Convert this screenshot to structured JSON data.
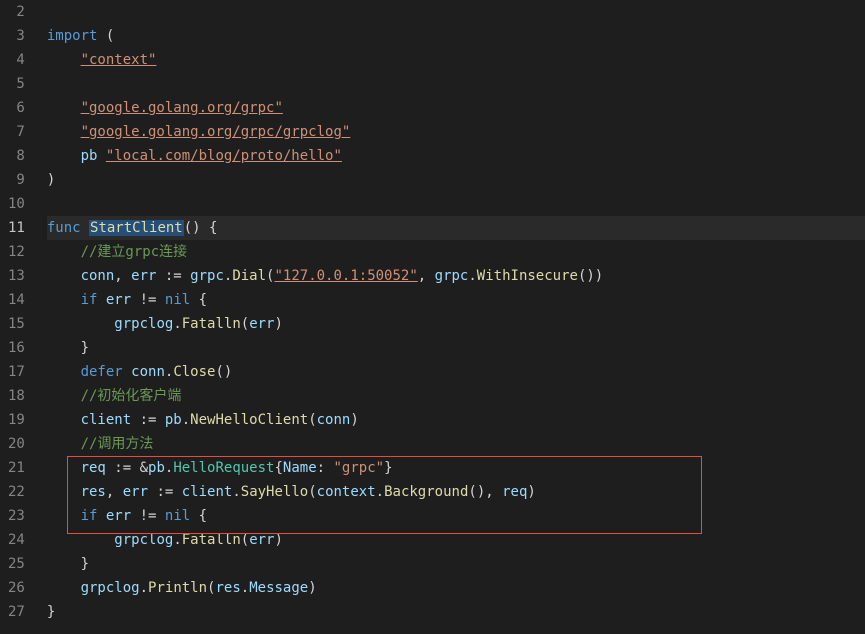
{
  "lineNumbers": [
    "2",
    "3",
    "4",
    "5",
    "6",
    "7",
    "8",
    "9",
    "10",
    "11",
    "12",
    "13",
    "14",
    "15",
    "16",
    "17",
    "18",
    "19",
    "20",
    "21",
    "22",
    "23",
    "24",
    "25",
    "26",
    "27"
  ],
  "currentLine": 11,
  "code": {
    "l3_import": "import",
    "l3_paren": " (",
    "l4_str": "\"context\"",
    "l6_str": "\"google.golang.org/grpc\"",
    "l7_str": "\"google.golang.org/grpc/grpclog\"",
    "l8_pb": "pb ",
    "l8_str": "\"local.com/blog/proto/hello\"",
    "l9_paren": ")",
    "l11_func": "func",
    "l11_name": "StartClient",
    "l11_sig": "() {",
    "l12_comment": "//建立grpc连接",
    "l13_conn": "conn",
    "l13_comma": ", ",
    "l13_err": "err",
    "l13_assign": " := ",
    "l13_grpc": "grpc",
    "l13_dot": ".",
    "l13_dial": "Dial",
    "l13_open": "(",
    "l13_addr": "\"127.0.0.1:50052\"",
    "l13_comma2": ", ",
    "l13_grpc2": "grpc",
    "l13_dot2": ".",
    "l13_withins": "WithInsecure",
    "l13_close": "())",
    "l14_if": "if",
    "l14_sp": " ",
    "l14_err": "err",
    "l14_ne": " != ",
    "l14_nil": "nil",
    "l14_brace": " {",
    "l15_grpclog": "grpclog",
    "l15_dot": ".",
    "l15_fatal": "Fatalln",
    "l15_open": "(",
    "l15_err": "err",
    "l15_close": ")",
    "l16_brace": "}",
    "l17_defer": "defer",
    "l17_sp": " ",
    "l17_conn": "conn",
    "l17_dot": ".",
    "l17_close": "Close",
    "l17_paren": "()",
    "l18_comment": "//初始化客户端",
    "l19_client": "client",
    "l19_assign": " := ",
    "l19_pb": "pb",
    "l19_dot": ".",
    "l19_newhello": "NewHelloClient",
    "l19_open": "(",
    "l19_conn": "conn",
    "l19_close": ")",
    "l20_comment": "//调用方法",
    "l21_req": "req",
    "l21_assign": " := &",
    "l21_pb": "pb",
    "l21_dot": ".",
    "l21_hr": "HelloRequest",
    "l21_brace": "{",
    "l21_name": "Name",
    "l21_colon": ": ",
    "l21_grpc": "\"grpc\"",
    "l21_close": "}",
    "l22_res": "res",
    "l22_comma": ", ",
    "l22_err": "err",
    "l22_assign": " := ",
    "l22_client": "client",
    "l22_dot": ".",
    "l22_sayhello": "SayHello",
    "l22_open": "(",
    "l22_context": "context",
    "l22_dot2": ".",
    "l22_bg": "Background",
    "l22_paren": "(), ",
    "l22_req": "req",
    "l22_close": ")",
    "l23_if": "if",
    "l23_sp": " ",
    "l23_err": "err",
    "l23_ne": " != ",
    "l23_nil": "nil",
    "l23_brace": " {",
    "l24_grpclog": "grpclog",
    "l24_dot": ".",
    "l24_fatal": "Fatalln",
    "l24_open": "(",
    "l24_err": "err",
    "l24_close": ")",
    "l25_brace": "}",
    "l26_grpclog": "grpclog",
    "l26_dot": ".",
    "l26_println": "Println",
    "l26_open": "(",
    "l26_res": "res",
    "l26_dot2": ".",
    "l26_msg": "Message",
    "l26_close": ")",
    "l27_brace": "}"
  }
}
